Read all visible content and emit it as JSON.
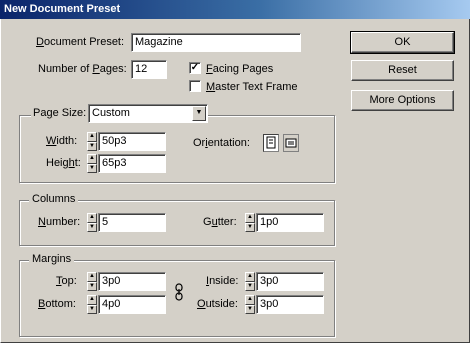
{
  "window": {
    "title": "New Document Preset"
  },
  "preset": {
    "label_prefix": "D",
    "label_rest": "ocument Preset:",
    "value": "Magazine"
  },
  "pages": {
    "label_pre": "Number of ",
    "label_u": "P",
    "label_post": "ages:",
    "value": "12"
  },
  "facing_pages": {
    "label_u": "F",
    "label_rest": "acing Pages",
    "checked_glyph": "✓"
  },
  "master_frame": {
    "label_u": "M",
    "label_rest": "aster Text Frame"
  },
  "page_size": {
    "label_pre": "Pa",
    "label_u": "g",
    "label_post": "e Size:",
    "value": "Custom"
  },
  "width": {
    "label_u": "W",
    "label_rest": "idth:",
    "value": "50p3"
  },
  "height": {
    "label_pre": "Heig",
    "label_u": "h",
    "label_post": "t:",
    "value": "65p3"
  },
  "orientation": {
    "label_pre": "Or",
    "label_u": "i",
    "label_post": "entation:"
  },
  "columns": {
    "title": "Columns",
    "number": {
      "label_u": "N",
      "label_rest": "umber:",
      "value": "5"
    },
    "gutter": {
      "label_pre": "G",
      "label_u": "u",
      "label_post": "tter:",
      "value": "1p0"
    }
  },
  "margins": {
    "title": "Margins",
    "top": {
      "label_u": "T",
      "label_rest": "op:",
      "value": "3p0"
    },
    "bottom": {
      "label_u": "B",
      "label_rest": "ottom:",
      "value": "4p0"
    },
    "inside": {
      "label_u": "I",
      "label_rest": "nside:",
      "value": "3p0"
    },
    "outside": {
      "label_u": "O",
      "label_rest": "utside:",
      "value": "3p0"
    }
  },
  "buttons": {
    "ok": "OK",
    "reset": "Reset",
    "more_options": "More Options"
  },
  "icons": {
    "spin_up": "▲",
    "spin_down": "▼",
    "dropdown": "▼",
    "portrait": "portrait-orientation-icon",
    "landscape": "landscape-orientation-icon",
    "chain": "chain-link-icon"
  }
}
